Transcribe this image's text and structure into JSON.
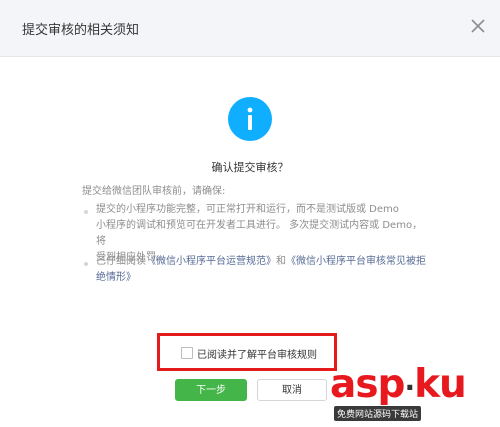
{
  "dialog": {
    "title": "提交审核的相关须知",
    "close_icon": "close-icon"
  },
  "confirm": {
    "icon": "info-icon",
    "icon_color": "#10aeff",
    "title": "确认提交审核？"
  },
  "notice": {
    "intro": "提交给微信团队审核前，请确保:",
    "item1_line1": "提交的小程序功能完整，可正常打开和运行，而不是测试版或 Demo",
    "item1_line2": "小程序的调试和预览可在开发者工具进行。 多次提交测试内容或 Demo，将",
    "item1_line3": "受到相应处罚。",
    "item2_prefix": "已仔细阅读",
    "item2_link1": "《微信小程序平台运营规范》",
    "item2_and": "和",
    "item2_link2_line1": "《微信小程序平台审核常见被拒",
    "item2_link2_line2": "绝情形》"
  },
  "agreement": {
    "checkbox_label": "已阅读并了解平台审核规则",
    "checked": false,
    "highlight_color": "#e51b1b"
  },
  "buttons": {
    "next_label": "下一步",
    "cancel_label": "取消",
    "primary_color": "#44b549"
  },
  "watermark": {
    "logo_main": "asp",
    "logo_sep": "·",
    "logo_end": "ku",
    "caption": "免费网站源码下载站"
  }
}
